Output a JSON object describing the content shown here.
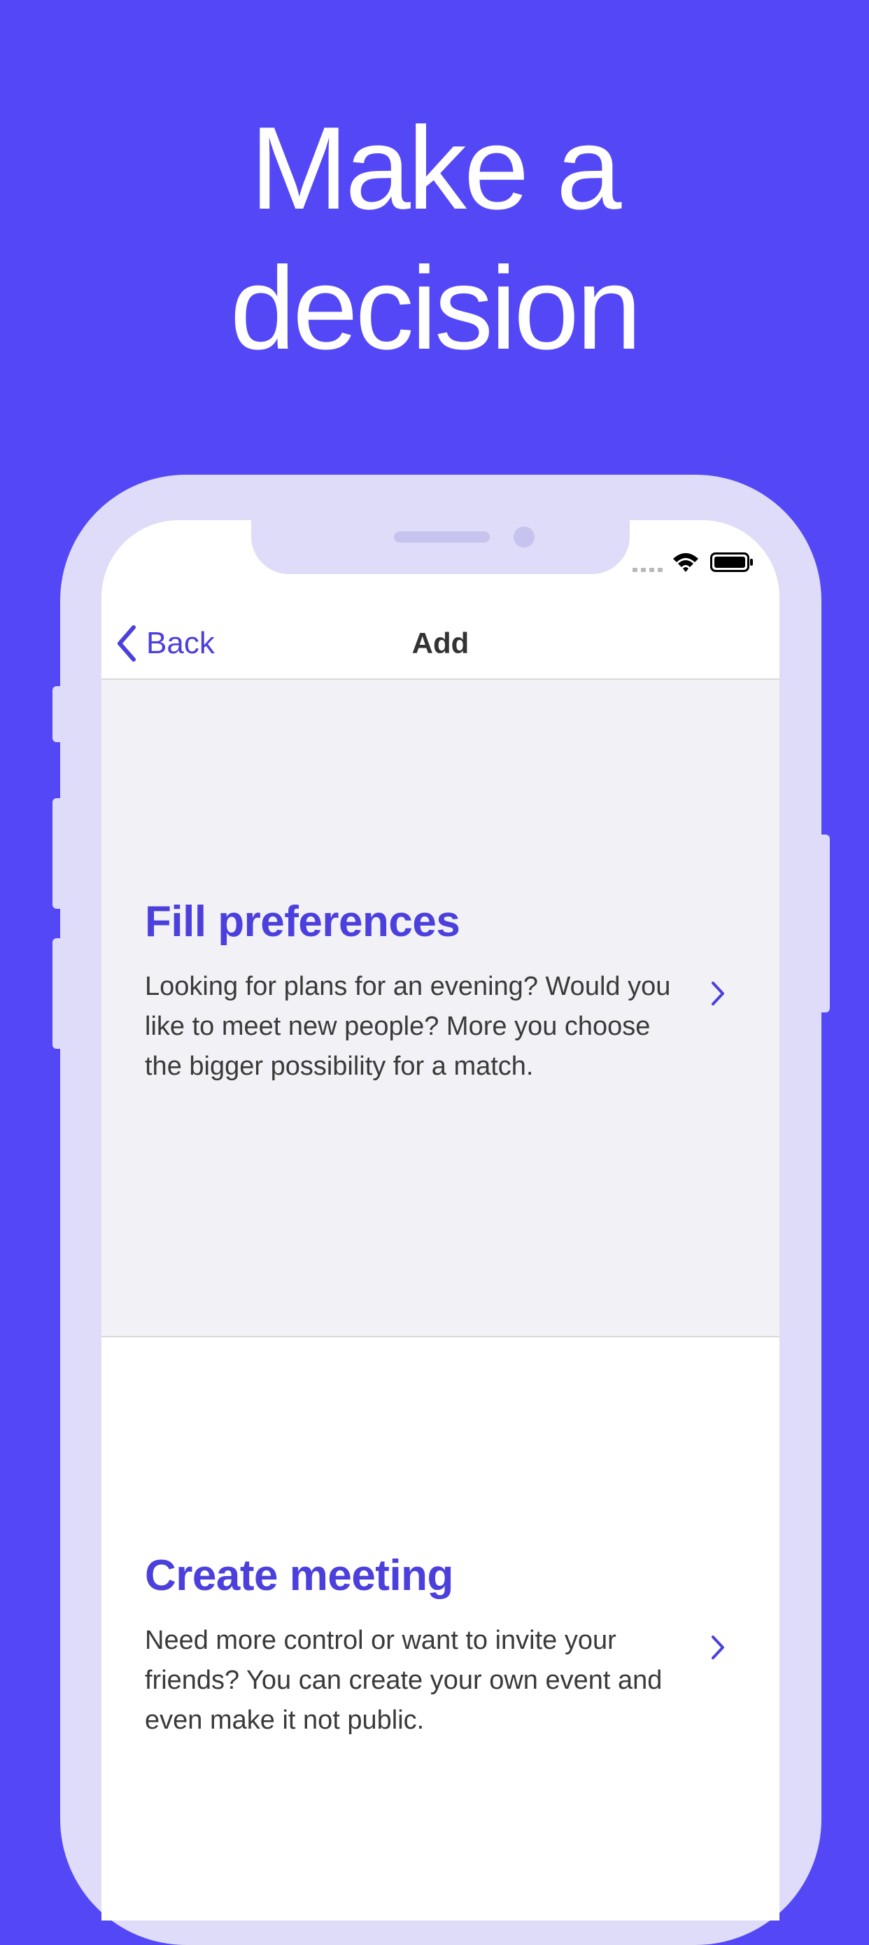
{
  "headline": {
    "line1": "Make a",
    "line2": "decision"
  },
  "navbar": {
    "back_label": "Back",
    "title": "Add"
  },
  "options": [
    {
      "title": "Fill preferences",
      "description": "Looking for plans for an evening? Would you like to meet new people? More you choose the bigger possibility for a match."
    },
    {
      "title": "Create meeting",
      "description": "Need more control or want to invite your friends? You can create your own event and even make it not public."
    }
  ],
  "colors": {
    "background": "#5448f6",
    "accent": "#4c40dd",
    "phone_frame": "#dedcf8"
  },
  "icons": [
    "chevron-left-icon",
    "chevron-right-icon",
    "wifi-icon",
    "battery-icon",
    "signal-icon"
  ]
}
